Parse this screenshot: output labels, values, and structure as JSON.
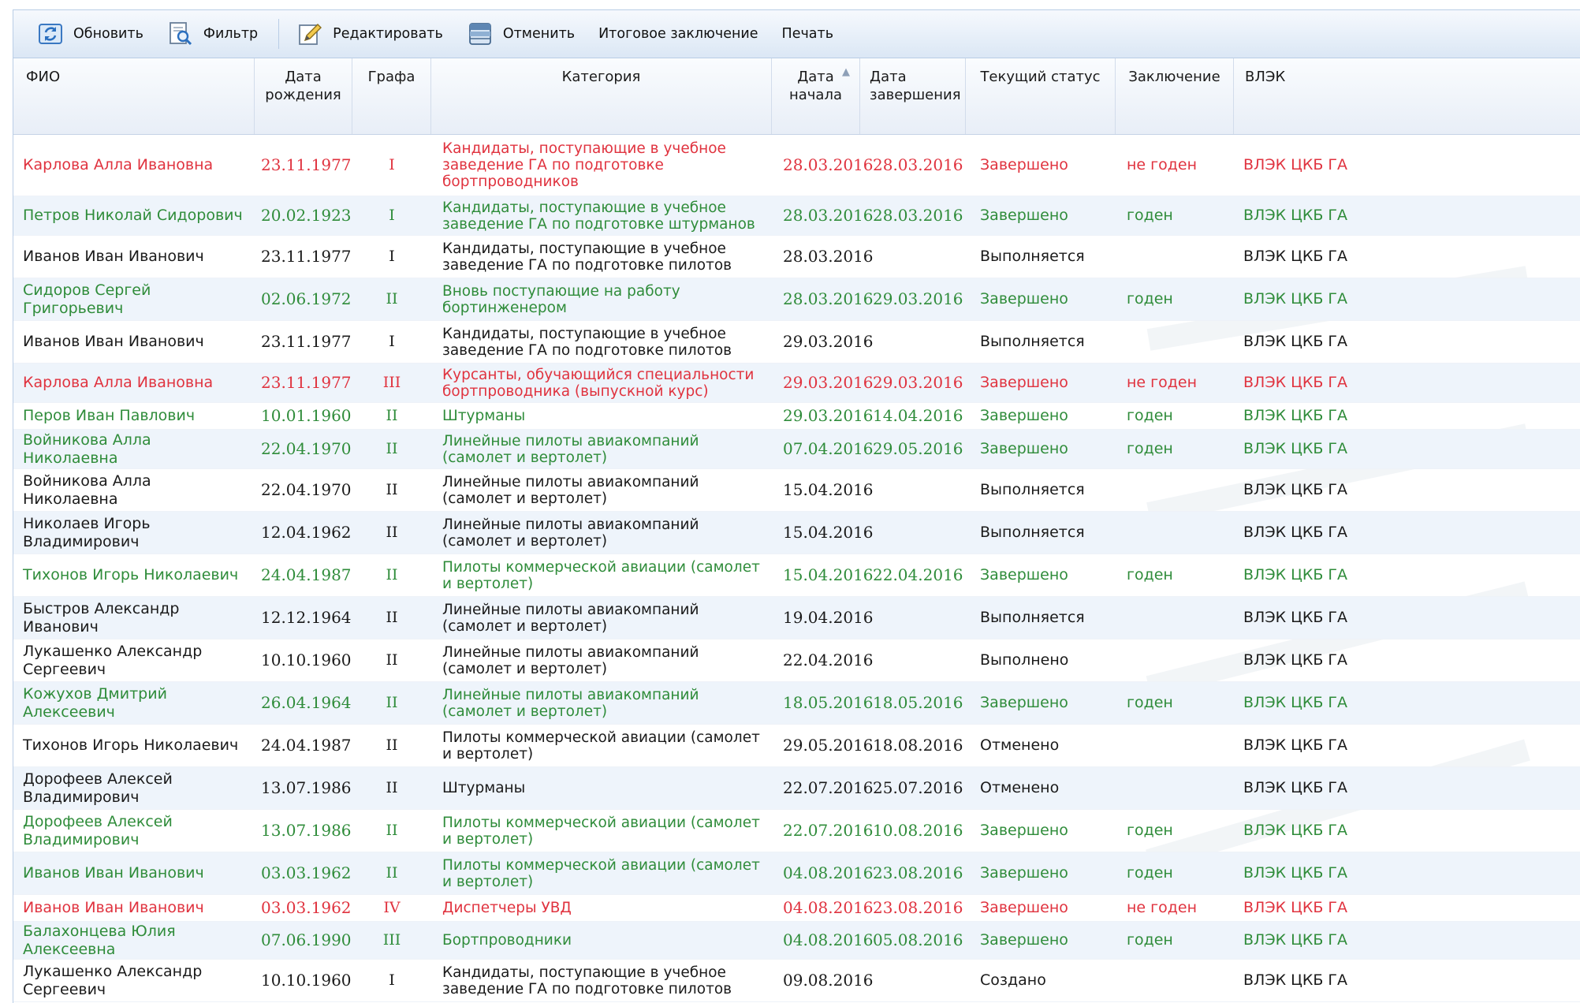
{
  "toolbar": {
    "refresh_label": "Обновить",
    "filter_label": "Фильтр",
    "edit_label": "Редактировать",
    "cancel_label": "Отменить",
    "final_label": "Итоговое заключение",
    "print_label": "Печать"
  },
  "columns": {
    "fio": "ФИО",
    "birth": "Дата рождения",
    "grafa": "Графа",
    "category": "Категория",
    "start": "Дата начала",
    "end": "Дата завершения",
    "status": "Текущий статус",
    "conclusion": "Заключение",
    "vlek": "ВЛЭК"
  },
  "status_colors": {
    "red": "#e0333f",
    "green": "#2f8c3a",
    "black": "#1a1a1a"
  },
  "rows": [
    {
      "fio": "Карлова Алла Ивановна",
      "birth": "23.11.1977",
      "grafa": "I",
      "category": "Кандидаты, поступающие в учебное заведение ГА по подготовке бортпроводников",
      "start": "28.03.2016",
      "end": "28.03.2016",
      "status": "Завершено",
      "conclusion": "не годен",
      "vlek": "ВЛЭК ЦКБ ГА",
      "color": "red"
    },
    {
      "fio": "Петров Николай Сидорович",
      "birth": "20.02.1923",
      "grafa": "I",
      "category": "Кандидаты, поступающие в учебное заведение ГА по подготовке штурманов",
      "start": "28.03.2016",
      "end": "28.03.2016",
      "status": "Завершено",
      "conclusion": "годен",
      "vlek": "ВЛЭК ЦКБ ГА",
      "color": "green"
    },
    {
      "fio": "Иванов Иван Иванович",
      "birth": "23.11.1977",
      "grafa": "I",
      "category": "Кандидаты, поступающие в учебное заведение ГА по подготовке пилотов",
      "start": "28.03.2016",
      "end": "",
      "status": "Выполняется",
      "conclusion": "",
      "vlek": "ВЛЭК ЦКБ ГА",
      "color": "black"
    },
    {
      "fio": "Сидоров Сергей Григорьевич",
      "birth": "02.06.1972",
      "grafa": "II",
      "category": "Вновь поступающие на работу бортинженером",
      "start": "28.03.2016",
      "end": "29.03.2016",
      "status": "Завершено",
      "conclusion": "годен",
      "vlek": "ВЛЭК ЦКБ ГА",
      "color": "green"
    },
    {
      "fio": "Иванов Иван Иванович",
      "birth": "23.11.1977",
      "grafa": "I",
      "category": "Кандидаты, поступающие в учебное заведение ГА по подготовке пилотов",
      "start": "29.03.2016",
      "end": "",
      "status": "Выполняется",
      "conclusion": "",
      "vlek": "ВЛЭК ЦКБ ГА",
      "color": "black"
    },
    {
      "fio": "Карлова Алла Ивановна",
      "birth": "23.11.1977",
      "grafa": "III",
      "category": "Курсанты, обучающийся специальности бортпроводника (выпускной курс)",
      "start": "29.03.2016",
      "end": "29.03.2016",
      "status": "Завершено",
      "conclusion": "не годен",
      "vlek": "ВЛЭК ЦКБ ГА",
      "color": "red"
    },
    {
      "fio": "Перов Иван Павлович",
      "birth": "10.01.1960",
      "grafa": "II",
      "category": "Штурманы",
      "start": "29.03.2016",
      "end": "14.04.2016",
      "status": "Завершено",
      "conclusion": "годен",
      "vlek": "ВЛЭК ЦКБ ГА",
      "color": "green"
    },
    {
      "fio": "Войникова Алла Николаевна",
      "birth": "22.04.1970",
      "grafa": "II",
      "category": "Линейные пилоты авиакомпаний (самолет и вертолет)",
      "start": "07.04.2016",
      "end": "29.05.2016",
      "status": "Завершено",
      "conclusion": "годен",
      "vlek": "ВЛЭК ЦКБ ГА",
      "color": "green"
    },
    {
      "fio": "Войникова Алла Николаевна",
      "birth": "22.04.1970",
      "grafa": "II",
      "category": "Линейные пилоты авиакомпаний (самолет и вертолет)",
      "start": "15.04.2016",
      "end": "",
      "status": "Выполняется",
      "conclusion": "",
      "vlek": "ВЛЭК ЦКБ ГА",
      "color": "black"
    },
    {
      "fio": "Николаев Игорь Владимирович",
      "birth": "12.04.1962",
      "grafa": "II",
      "category": "Линейные пилоты авиакомпаний (самолет и вертолет)",
      "start": "15.04.2016",
      "end": "",
      "status": "Выполняется",
      "conclusion": "",
      "vlek": "ВЛЭК ЦКБ ГА",
      "color": "black"
    },
    {
      "fio": "Тихонов Игорь Николаевич",
      "birth": "24.04.1987",
      "grafa": "II",
      "category": "Пилоты коммерческой авиации (самолет и вертолет)",
      "start": "15.04.2016",
      "end": "22.04.2016",
      "status": "Завершено",
      "conclusion": "годен",
      "vlek": "ВЛЭК ЦКБ ГА",
      "color": "green"
    },
    {
      "fio": "Быстров Александр Иванович",
      "birth": "12.12.1964",
      "grafa": "II",
      "category": "Линейные пилоты авиакомпаний (самолет и вертолет)",
      "start": "19.04.2016",
      "end": "",
      "status": "Выполняется",
      "conclusion": "",
      "vlek": "ВЛЭК ЦКБ ГА",
      "color": "black"
    },
    {
      "fio": "Лукашенко Александр Сергеевич",
      "birth": "10.10.1960",
      "grafa": "II",
      "category": "Линейные пилоты авиакомпаний (самолет и вертолет)",
      "start": "22.04.2016",
      "end": "",
      "status": "Выполнено",
      "conclusion": "",
      "vlek": "ВЛЭК ЦКБ ГА",
      "color": "black"
    },
    {
      "fio": "Кожухов Дмитрий Алексеевич",
      "birth": "26.04.1964",
      "grafa": "II",
      "category": "Линейные пилоты авиакомпаний (самолет и вертолет)",
      "start": "18.05.2016",
      "end": "18.05.2016",
      "status": "Завершено",
      "conclusion": "годен",
      "vlek": "ВЛЭК ЦКБ ГА",
      "color": "green"
    },
    {
      "fio": "Тихонов Игорь Николаевич",
      "birth": "24.04.1987",
      "grafa": "II",
      "category": "Пилоты коммерческой авиации (самолет и вертолет)",
      "start": "29.05.2016",
      "end": "18.08.2016",
      "status": "Отменено",
      "conclusion": "",
      "vlek": "ВЛЭК ЦКБ ГА",
      "color": "black"
    },
    {
      "fio": "Дорофеев Алексей Владимирович",
      "birth": "13.07.1986",
      "grafa": "II",
      "category": "Штурманы",
      "start": "22.07.2016",
      "end": "25.07.2016",
      "status": "Отменено",
      "conclusion": "",
      "vlek": "ВЛЭК ЦКБ ГА",
      "color": "black"
    },
    {
      "fio": "Дорофеев Алексей Владимирович",
      "birth": "13.07.1986",
      "grafa": "II",
      "category": "Пилоты коммерческой авиации (самолет и вертолет)",
      "start": "22.07.2016",
      "end": "10.08.2016",
      "status": "Завершено",
      "conclusion": "годен",
      "vlek": "ВЛЭК ЦКБ ГА",
      "color": "green"
    },
    {
      "fio": "Иванов Иван Иванович",
      "birth": "03.03.1962",
      "grafa": "II",
      "category": "Пилоты коммерческой авиации (самолет и вертолет)",
      "start": "04.08.2016",
      "end": "23.08.2016",
      "status": "Завершено",
      "conclusion": "годен",
      "vlek": "ВЛЭК ЦКБ ГА",
      "color": "green"
    },
    {
      "fio": "Иванов Иван Иванович",
      "birth": "03.03.1962",
      "grafa": "IV",
      "category": "Диспетчеры УВД",
      "start": "04.08.2016",
      "end": "23.08.2016",
      "status": "Завершено",
      "conclusion": "не годен",
      "vlek": "ВЛЭК ЦКБ ГА",
      "color": "red"
    },
    {
      "fio": "Балахонцева Юлия Алексеевна",
      "birth": "07.06.1990",
      "grafa": "III",
      "category": "Бортпроводники",
      "start": "04.08.2016",
      "end": "05.08.2016",
      "status": "Завершено",
      "conclusion": "годен",
      "vlek": "ВЛЭК ЦКБ ГА",
      "color": "green"
    },
    {
      "fio": "Лукашенко Александр Сергеевич",
      "birth": "10.10.1960",
      "grafa": "I",
      "category": "Кандидаты, поступающие в учебное заведение ГА по подготовке пилотов",
      "start": "09.08.2016",
      "end": "",
      "status": "Создано",
      "conclusion": "",
      "vlek": "ВЛЭК ЦКБ ГА",
      "color": "black"
    }
  ]
}
